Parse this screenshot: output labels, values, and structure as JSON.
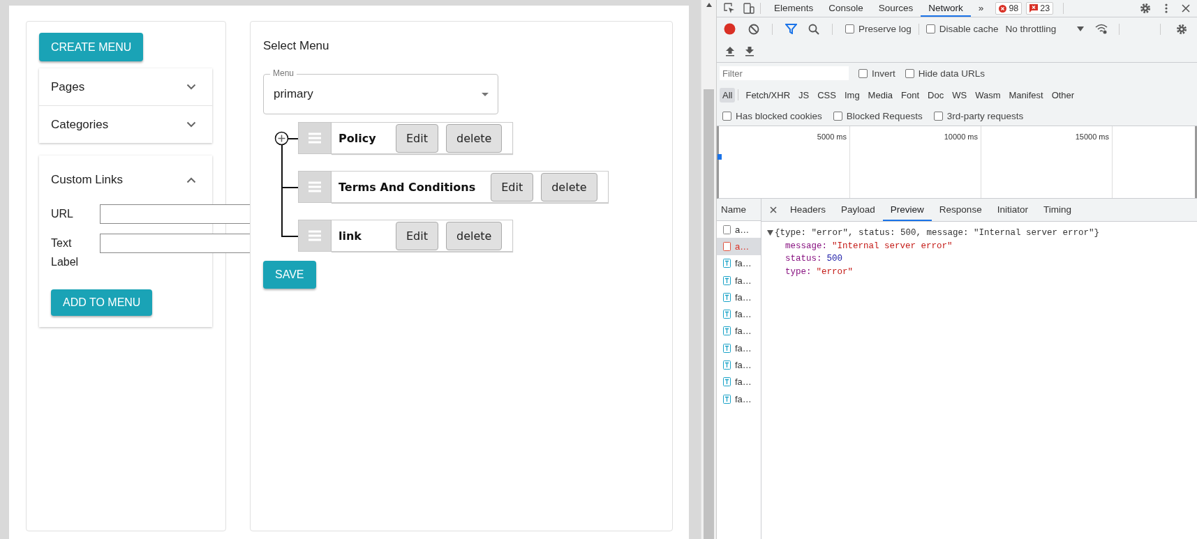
{
  "page": {
    "create_button": "CREATE MENU",
    "accordions": [
      {
        "title": "Pages",
        "expanded": false
      },
      {
        "title": "Categories",
        "expanded": false
      }
    ],
    "custom_links": {
      "title": "Custom Links",
      "expanded": true,
      "fields": [
        {
          "label": "URL"
        },
        {
          "label": "Text Label"
        }
      ],
      "button": "ADD TO MENU"
    },
    "select_title": "Select Menu",
    "menu_select": {
      "label": "Menu",
      "value": "primary"
    },
    "menu_items": [
      {
        "label": "Policy",
        "edit": "Edit",
        "delete": "delete"
      },
      {
        "label": "Terms And Conditions",
        "edit": "Edit",
        "delete": "delete"
      },
      {
        "label": "link",
        "edit": "Edit",
        "delete": "delete"
      }
    ],
    "save_button": "SAVE"
  },
  "devtools": {
    "tabs": [
      {
        "label": "Elements",
        "selected": false
      },
      {
        "label": "Console",
        "selected": false
      },
      {
        "label": "Sources",
        "selected": false
      },
      {
        "label": "Network",
        "selected": true
      }
    ],
    "more": "»",
    "error_count": "98",
    "warning_count": "23",
    "toolbar": {
      "recording": true,
      "filter_active": true,
      "checkboxes": [
        {
          "label": "Preserve log",
          "checked": false
        },
        {
          "label": "Disable cache",
          "checked": false
        }
      ],
      "throttling": "No throttling"
    },
    "filter": {
      "placeholder": "Filter",
      "checkboxes": [
        {
          "label": "Invert",
          "checked": false
        },
        {
          "label": "Hide data URLs",
          "checked": false
        }
      ]
    },
    "types": [
      {
        "label": "All",
        "selected": true
      },
      {
        "label": "Fetch/XHR",
        "selected": false
      },
      {
        "label": "JS",
        "selected": false
      },
      {
        "label": "CSS",
        "selected": false
      },
      {
        "label": "Img",
        "selected": false
      },
      {
        "label": "Media",
        "selected": false
      },
      {
        "label": "Font",
        "selected": false
      },
      {
        "label": "Doc",
        "selected": false
      },
      {
        "label": "WS",
        "selected": false
      },
      {
        "label": "Wasm",
        "selected": false
      },
      {
        "label": "Manifest",
        "selected": false
      },
      {
        "label": "Other",
        "selected": false
      }
    ],
    "request_filters": [
      {
        "label": "Has blocked cookies",
        "checked": false
      },
      {
        "label": "Blocked Requests",
        "checked": false
      },
      {
        "label": "3rd-party requests",
        "checked": false
      }
    ],
    "timeline_ticks": [
      "5000 ms",
      "10000 ms",
      "15000 ms"
    ],
    "requests": {
      "header": "Name",
      "rows": [
        {
          "name": "a…",
          "kind": "document",
          "selected": false
        },
        {
          "name": "a…",
          "kind": "error",
          "selected": true
        },
        {
          "name": "fa…",
          "kind": "text",
          "selected": false
        },
        {
          "name": "fa…",
          "kind": "text",
          "selected": false
        },
        {
          "name": "fa…",
          "kind": "text",
          "selected": false
        },
        {
          "name": "fa…",
          "kind": "text",
          "selected": false
        },
        {
          "name": "fa…",
          "kind": "text",
          "selected": false
        },
        {
          "name": "fa…",
          "kind": "text",
          "selected": false
        },
        {
          "name": "fa…",
          "kind": "text",
          "selected": false
        },
        {
          "name": "fa…",
          "kind": "text",
          "selected": false
        },
        {
          "name": "fa…",
          "kind": "text",
          "selected": false
        }
      ]
    },
    "detail_tabs": [
      {
        "label": "Headers",
        "selected": false
      },
      {
        "label": "Payload",
        "selected": false
      },
      {
        "label": "Preview",
        "selected": true
      },
      {
        "label": "Response",
        "selected": false
      },
      {
        "label": "Initiator",
        "selected": false
      },
      {
        "label": "Timing",
        "selected": false
      }
    ],
    "preview": {
      "expanded": true,
      "summary": "{type: \"error\", status: 500, message: \"Internal server error\"}",
      "properties": [
        {
          "key": "message:",
          "value": "\"Internal server error\"",
          "kind": "string"
        },
        {
          "key": "status:",
          "value": "500",
          "kind": "number"
        },
        {
          "key": "type:",
          "value": "\"error\"",
          "kind": "string"
        }
      ]
    }
  }
}
